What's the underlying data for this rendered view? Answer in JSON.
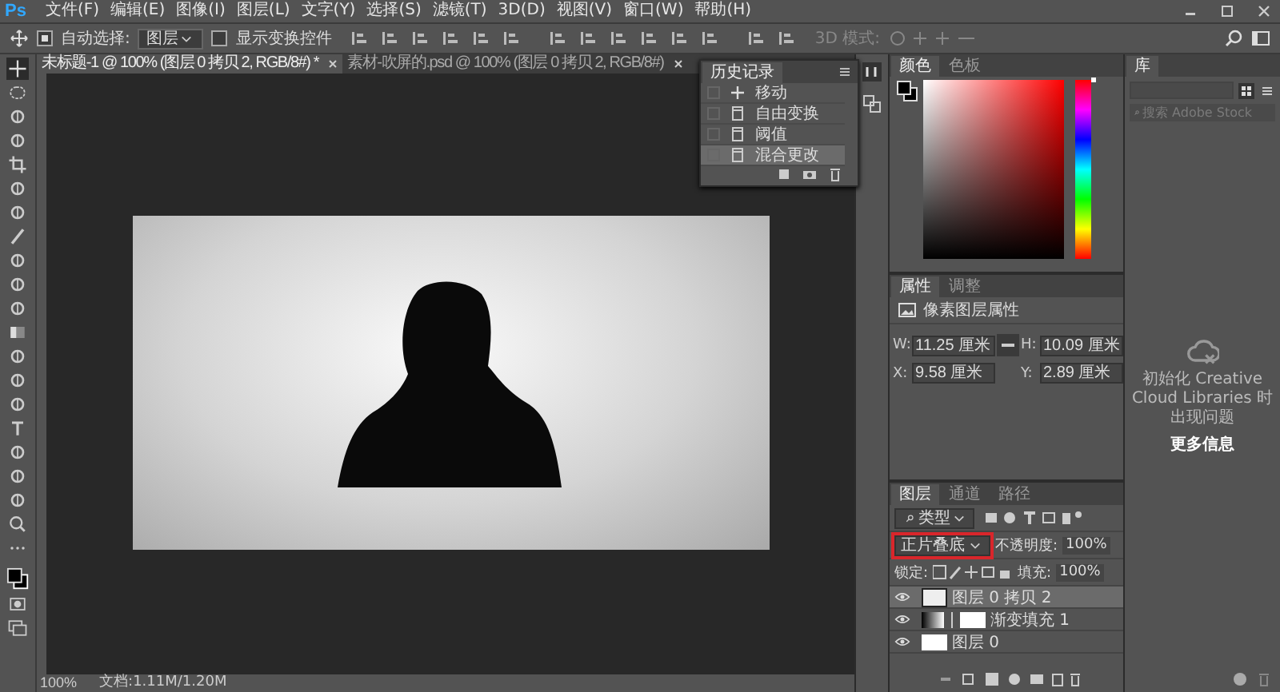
{
  "app_logo": "Ps",
  "menu": [
    "文件(F)",
    "编辑(E)",
    "图像(I)",
    "图层(L)",
    "文字(Y)",
    "选择(S)",
    "滤镜(T)",
    "3D(D)",
    "视图(V)",
    "窗口(W)",
    "帮助(H)"
  ],
  "options_bar": {
    "auto_select": {
      "label": "自动选择:",
      "checked": true
    },
    "auto_select_target": "图层",
    "show_transform": {
      "label": "显示变换控件",
      "checked": false
    },
    "mode_3d": "3D 模式:"
  },
  "tools": [
    {
      "selected": true
    },
    {
      "selected": false
    },
    {
      "selected": false
    },
    {
      "selected": false
    },
    {
      "selected": false
    },
    {
      "selected": false
    },
    {
      "selected": false
    },
    {
      "selected": false
    },
    {
      "selected": false
    },
    {
      "selected": false
    },
    {
      "selected": false
    },
    {
      "selected": false
    },
    {
      "selected": false
    },
    {
      "selected": false
    },
    {
      "selected": false
    },
    {
      "selected": false
    },
    {
      "selected": false
    },
    {
      "selected": false
    },
    {
      "selected": false
    },
    {
      "selected": false
    },
    {
      "selected": false
    }
  ],
  "doc_tabs": [
    {
      "label": "未标题-1 @ 100% (图层 0 拷贝 2, RGB/8#) *",
      "selected": true
    },
    {
      "label": "素材-吹屏的.psd @ 100% (图层 0 拷贝 2, RGB/8#)",
      "selected": false
    }
  ],
  "history": {
    "title": "历史记录",
    "items": [
      {
        "label": "移动",
        "kind": "move",
        "selected": false
      },
      {
        "label": "自由变换",
        "kind": "doc",
        "selected": false
      },
      {
        "label": "阈值",
        "kind": "doc",
        "selected": false
      },
      {
        "label": "混合更改",
        "kind": "doc",
        "selected": true
      }
    ]
  },
  "status_bar": {
    "zoom": "100%",
    "doc_size": "文档:1.11M/1.20M"
  },
  "color_panel": {
    "tabs": [
      {
        "label": "颜色",
        "selected": true
      },
      {
        "label": "色板",
        "selected": false
      }
    ],
    "hue": {
      "level": 1
    }
  },
  "properties": {
    "tabs": [
      {
        "label": "属性",
        "selected": true
      },
      {
        "label": "调整",
        "selected": false
      }
    ],
    "title": "像素图层属性",
    "fields": [
      {
        "label": "W:",
        "value": "11.25 厘米"
      },
      {
        "label": "H:",
        "value": "10.09 厘米"
      },
      {
        "label": "X:",
        "value": "9.58 厘米"
      },
      {
        "label": "Y:",
        "value": "2.89 厘米"
      }
    ]
  },
  "layers_panel": {
    "tabs": [
      {
        "label": "图层",
        "selected": true
      },
      {
        "label": "通道",
        "selected": false
      },
      {
        "label": "路径",
        "selected": false
      }
    ],
    "filter": "类型",
    "blend_mode": "正片叠底",
    "blend_highlighted": true,
    "opacity_label": "不透明度:",
    "opacity": "100%",
    "lock_label": "锁定:",
    "fill_label": "填充:",
    "fill": "100%",
    "layers": [
      {
        "name": "图层 0 拷贝 2",
        "kind": "image",
        "visible": true,
        "selected": true
      },
      {
        "name": "渐变填充 1",
        "kind": "gradient",
        "visible": true,
        "selected": false
      },
      {
        "name": "图层 0",
        "kind": "pixel",
        "visible": true,
        "selected": false
      }
    ]
  },
  "library": {
    "title": "库",
    "search_placeholder": "搜索 Adobe Stock",
    "message": "初始化 Creative Cloud Libraries 时出现问题",
    "link": "更多信息"
  }
}
